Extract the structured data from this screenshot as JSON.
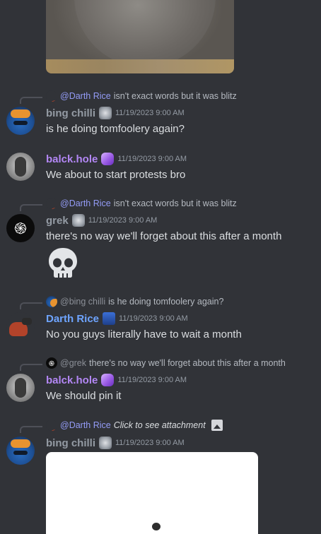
{
  "colors": {
    "background": "#313338",
    "mention": "#949cf7",
    "purple_name": "#b387f5",
    "blue_name": "#6ea4ff",
    "text": "#dbdee1",
    "muted": "#949ba4"
  },
  "messages": [
    {
      "reply": {
        "mention": "@Darth Rice",
        "text": "isn't exact words but it was blitz"
      },
      "author": "bing chilli",
      "badge_icon": "robot-badge-icon",
      "timestamp": "11/19/2023 9:00 AM",
      "text": "is he doing tomfoolery again?"
    },
    {
      "author": "balck.hole",
      "badge_icon": "crystal-badge-icon",
      "timestamp": "11/19/2023 9:00 AM",
      "text": "We about to start protests bro"
    },
    {
      "reply": {
        "mention": "@Darth Rice",
        "text": "isn't exact words but it was blitz"
      },
      "author": "grek",
      "badge_icon": "robot-badge-icon",
      "timestamp": "11/19/2023 9:00 AM",
      "text": "there's no way we'll forget about this after a month",
      "emoji": "skull-emoji-icon"
    },
    {
      "reply": {
        "mention": "@bing chilli",
        "text": "is he doing tomfoolery again?"
      },
      "author": "Darth Rice",
      "badge_icon": "jar-badge-icon",
      "timestamp": "11/19/2023 9:00 AM",
      "text": "No you guys literally have to wait a month"
    },
    {
      "reply": {
        "mention": "@grek",
        "text": "there's no way we'll forget about this after a month"
      },
      "author": "balck.hole",
      "badge_icon": "crystal-badge-icon",
      "timestamp": "11/19/2023 9:00 AM",
      "text": "We should pin it"
    },
    {
      "reply": {
        "mention": "@Darth Rice",
        "text": "Click to see attachment",
        "icon": "image-icon"
      },
      "author": "bing chilli",
      "badge_icon": "robot-badge-icon",
      "timestamp": "11/19/2023 9:00 AM",
      "attachment": "image-attachment"
    }
  ]
}
